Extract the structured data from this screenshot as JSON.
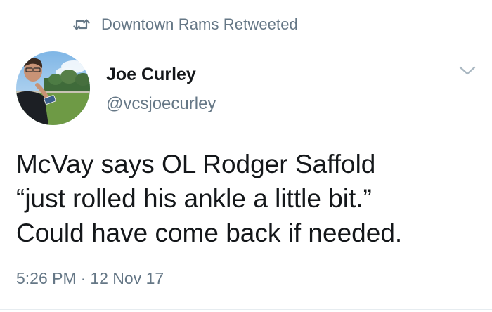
{
  "retweet_context": {
    "text": "Downtown Rams Retweeted",
    "icon": "retweet-icon"
  },
  "author": {
    "name": "Joe Curley",
    "handle": "@vcsjoecurley",
    "avatar_icon": "profile-photo"
  },
  "tweet": {
    "lines": [
      "McVay says OL Rodger Saffold",
      "“just rolled his ankle a little bit.”",
      "Could have come back if needed."
    ],
    "time": "5:26 PM",
    "separator": "·",
    "date": "12 Nov 17"
  },
  "menu": {
    "icon": "chevron-down-icon"
  },
  "colors": {
    "text_primary": "#14171a",
    "text_secondary": "#657786",
    "divider": "#e6ecf0",
    "background": "#ffffff"
  }
}
